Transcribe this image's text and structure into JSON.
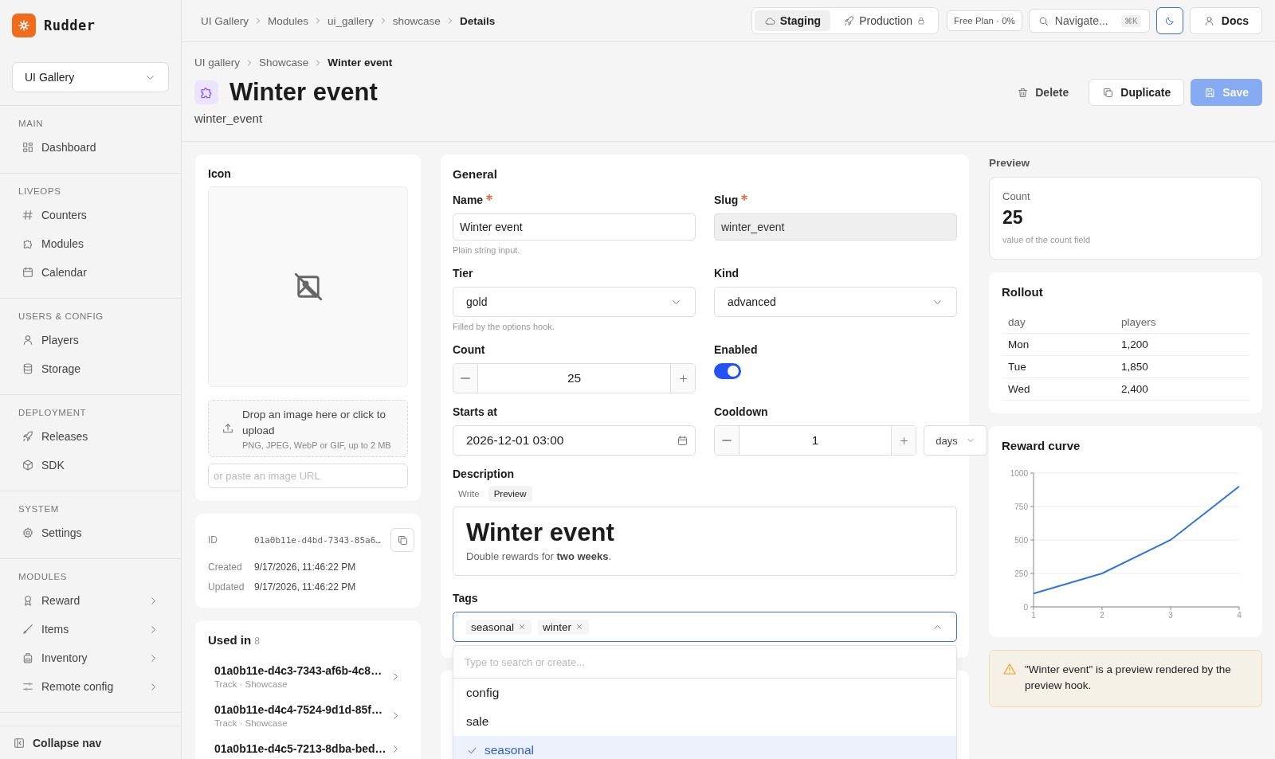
{
  "app": {
    "name": "Rudder"
  },
  "workspace": {
    "value": "UI Gallery"
  },
  "sidebar": {
    "sections": [
      {
        "title": "MAIN",
        "items": [
          {
            "label": "Dashboard",
            "kind": "link"
          }
        ]
      },
      {
        "title": "LIVEOPS",
        "items": [
          {
            "label": "Counters",
            "kind": "link"
          },
          {
            "label": "Modules",
            "kind": "link"
          },
          {
            "label": "Calendar",
            "kind": "link"
          }
        ]
      },
      {
        "title": "USERS & CONFIG",
        "items": [
          {
            "label": "Players",
            "kind": "link"
          },
          {
            "label": "Storage",
            "kind": "link"
          }
        ]
      },
      {
        "title": "DEPLOYMENT",
        "items": [
          {
            "label": "Releases",
            "kind": "link"
          },
          {
            "label": "SDK",
            "kind": "link"
          }
        ]
      },
      {
        "title": "SYSTEM",
        "items": [
          {
            "label": "Settings",
            "kind": "link"
          }
        ]
      },
      {
        "title": "MODULES",
        "items": [
          {
            "label": "Reward",
            "kind": "group",
            "expanded": false
          },
          {
            "label": "Items",
            "kind": "group",
            "expanded": false
          },
          {
            "label": "Inventory",
            "kind": "group",
            "expanded": false
          },
          {
            "label": "Remote config",
            "kind": "group",
            "expanded": false
          }
        ]
      }
    ],
    "collapse": "Collapse nav"
  },
  "topbar": {
    "breadcrumbs": [
      "UI Gallery",
      "Modules",
      "ui_gallery",
      "showcase",
      "Details"
    ],
    "environments": [
      {
        "label": "Staging",
        "selected": true,
        "locked": false
      },
      {
        "label": "Production",
        "selected": false,
        "locked": true
      }
    ],
    "plan": "Free Plan · 0%",
    "search": {
      "placeholder": "Navigate...",
      "shortcut": "⌘K"
    },
    "docs": "Docs"
  },
  "header": {
    "breadcrumbs": [
      "UI gallery",
      "Showcase",
      "Winter event"
    ],
    "title": "Winter event",
    "subtitle": "winter_event",
    "actions": [
      {
        "label": "Delete",
        "kind": "ghost",
        "disabled": false
      },
      {
        "label": "Duplicate",
        "kind": "outline",
        "disabled": false
      },
      {
        "label": "Save",
        "kind": "primary",
        "disabled": true
      }
    ]
  },
  "icon_card": {
    "title": "Icon",
    "drop_text": "Drop an image here or click to upload",
    "drop_hint": "PNG, JPEG, WebP or GIF, up to 2 MB",
    "url_placeholder": "or paste an image URL"
  },
  "meta": [
    {
      "label": "ID",
      "value": "01a0b11e-d4bd-7343-85a6…",
      "kind": "id"
    },
    {
      "label": "Created",
      "value": "9/17/2026, 11:46:22 PM",
      "kind": "date"
    },
    {
      "label": "Updated",
      "value": "9/17/2026, 11:46:22 PM",
      "kind": "date"
    }
  ],
  "used_in": {
    "title": "Used in",
    "count": "8",
    "items": [
      {
        "title": "01a0b11e-d4c3-7343-af6b-4c8…",
        "subtitle": "Track · Showcase"
      },
      {
        "title": "01a0b11e-d4c4-7524-9d1d-85f…",
        "subtitle": "Track · Showcase"
      },
      {
        "title": "01a0b11e-d4c5-7213-8dba-bed…"
      }
    ]
  },
  "general": {
    "title": "General",
    "fields": [
      {
        "kind": "text",
        "label": "Name",
        "required": true,
        "value": "Winter event",
        "readonly": false,
        "help": "Plain string input."
      },
      {
        "kind": "text",
        "label": "Slug",
        "required": true,
        "value": "winter_event",
        "readonly": true
      },
      {
        "kind": "select",
        "label": "Tier",
        "required": false,
        "value": "gold",
        "help": "Filled by the options hook."
      },
      {
        "kind": "select",
        "label": "Kind",
        "required": false,
        "value": "advanced"
      },
      {
        "kind": "stepper",
        "label": "Count",
        "required": false,
        "value": "25"
      },
      {
        "kind": "toggle",
        "label": "Enabled",
        "required": false,
        "on": true
      },
      {
        "kind": "datetime",
        "label": "Starts at",
        "required": false,
        "value": "2026-12-01 03:00"
      },
      {
        "kind": "stepper",
        "label": "Cooldown",
        "required": false,
        "value": "1",
        "unit": "days"
      }
    ],
    "description": {
      "label": "Description",
      "tabs": [
        {
          "label": "Write",
          "selected": false
        },
        {
          "label": "Preview",
          "selected": true
        }
      ],
      "heading": "Winter event",
      "body": "Double rewards for **two weeks**."
    },
    "tags": {
      "label": "Tags",
      "chips": [
        "seasonal",
        "winter"
      ],
      "expanded": true,
      "search_placeholder": "Type to search or create...",
      "options": [
        {
          "label": "config",
          "selected": false
        },
        {
          "label": "sale",
          "selected": false
        },
        {
          "label": "seasonal",
          "selected": true
        }
      ]
    }
  },
  "preview": {
    "title": "Preview",
    "stat": {
      "label": "Count",
      "value": "25",
      "caption": "value of the count field"
    },
    "rollout": {
      "title": "Rollout",
      "columns": [
        "day",
        "players"
      ],
      "rows": [
        [
          "Mon",
          "1,200"
        ],
        [
          "Tue",
          "1,850"
        ],
        [
          "Wed",
          "2,400"
        ]
      ]
    },
    "chart": {
      "title": "Reward curve",
      "chart_data": {
        "type": "line",
        "x": [
          1,
          2,
          3,
          4
        ],
        "grid": true,
        "series": [
          {
            "color": "#2f74e0",
            "values": [
              100,
              250,
              500,
              900
            ]
          }
        ],
        "xlim": [
          1,
          4
        ],
        "ylim": [
          0,
          1000
        ],
        "xticks": [
          1,
          2,
          3,
          4
        ],
        "yticks": [
          0,
          250,
          500,
          750,
          1000
        ]
      }
    },
    "alert": {
      "kind": "warning",
      "text": "\"Winter event\" is a preview rendered by the preview hook."
    }
  }
}
